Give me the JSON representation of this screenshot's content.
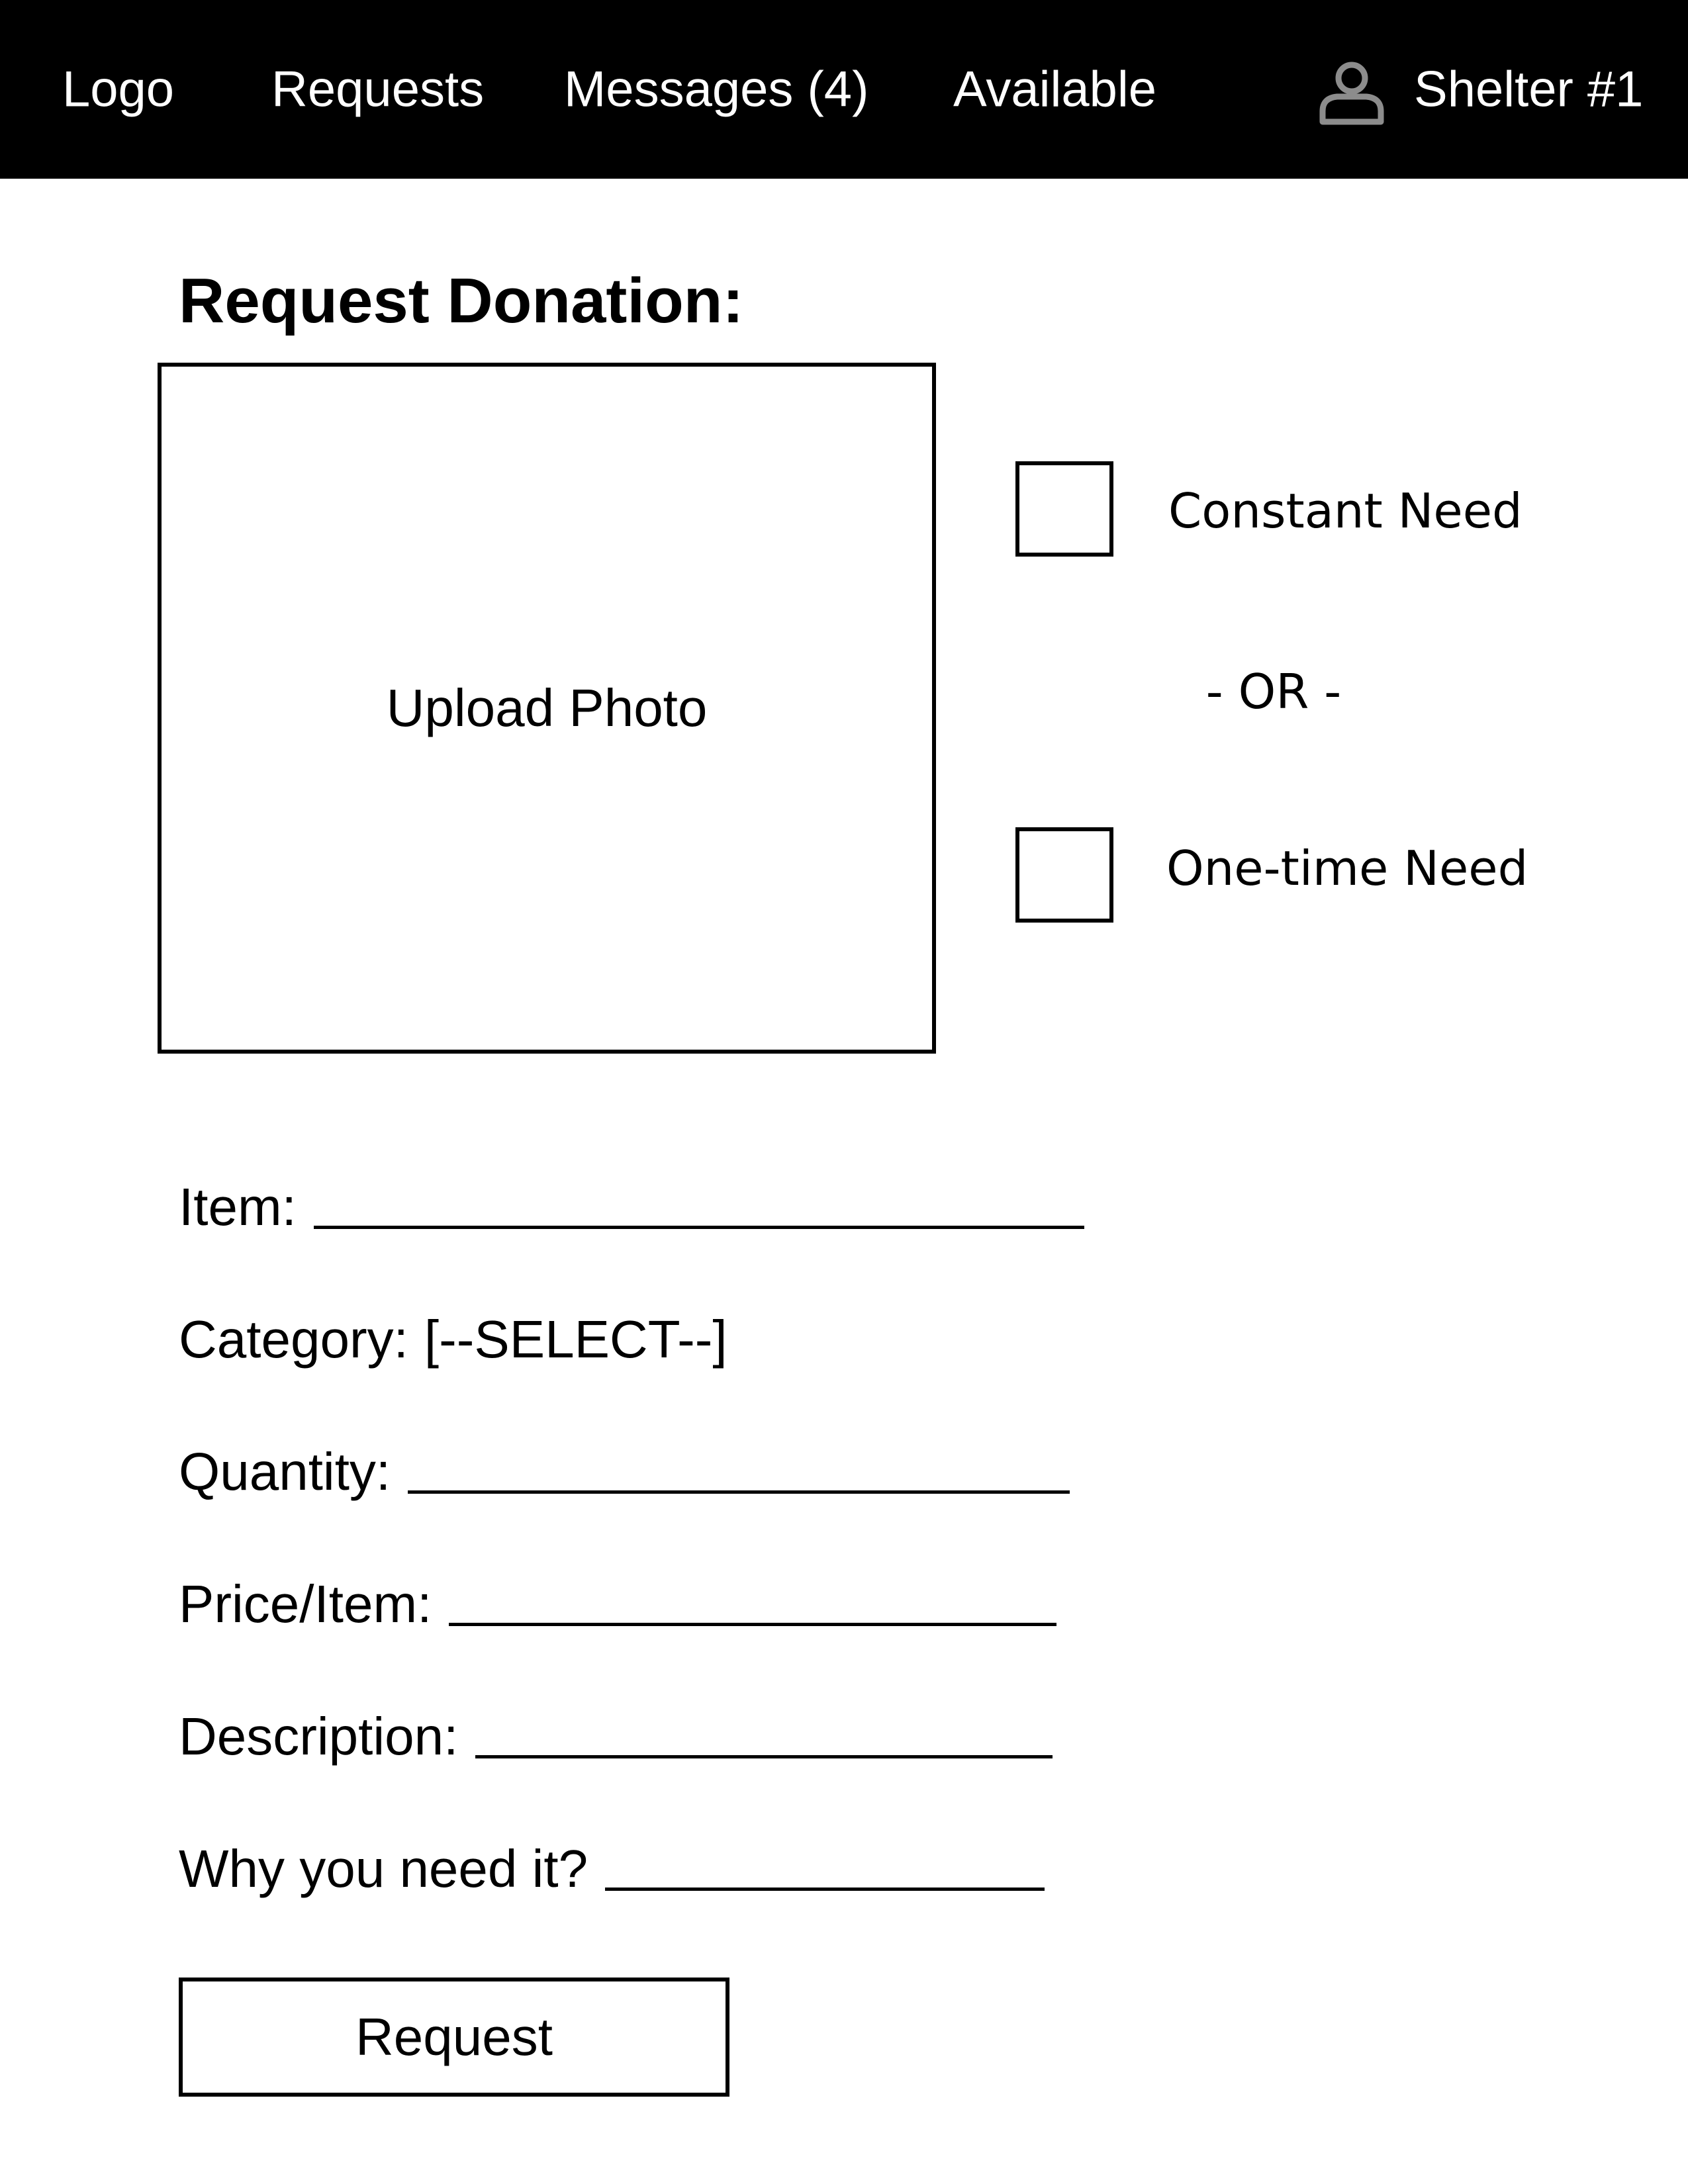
{
  "nav": {
    "logo": "Logo",
    "requests": "Requests",
    "messages": "Messages (4)",
    "available": "Available",
    "user_icon": "user-icon",
    "user_name": "Shelter #1"
  },
  "form": {
    "title": "Request Donation:",
    "upload_label": "Upload Photo",
    "need_type": {
      "constant_label": "Constant Need",
      "separator": "- OR -",
      "one_time_label": "One-time Need"
    },
    "fields": {
      "item_label": "Item:",
      "category_label": "Category:",
      "category_value": "[--SELECT--]",
      "quantity_label": "Quantity:",
      "price_label": "Price/Item:",
      "description_label": "Description:",
      "why_label": "Why you need it?"
    },
    "submit_label": "Request"
  },
  "colors": {
    "navbar_background": "#000000",
    "navbar_text": "#ffffff",
    "user_icon": "#8c8c8c",
    "page_background": "#ffffff",
    "ink": "#000000"
  }
}
